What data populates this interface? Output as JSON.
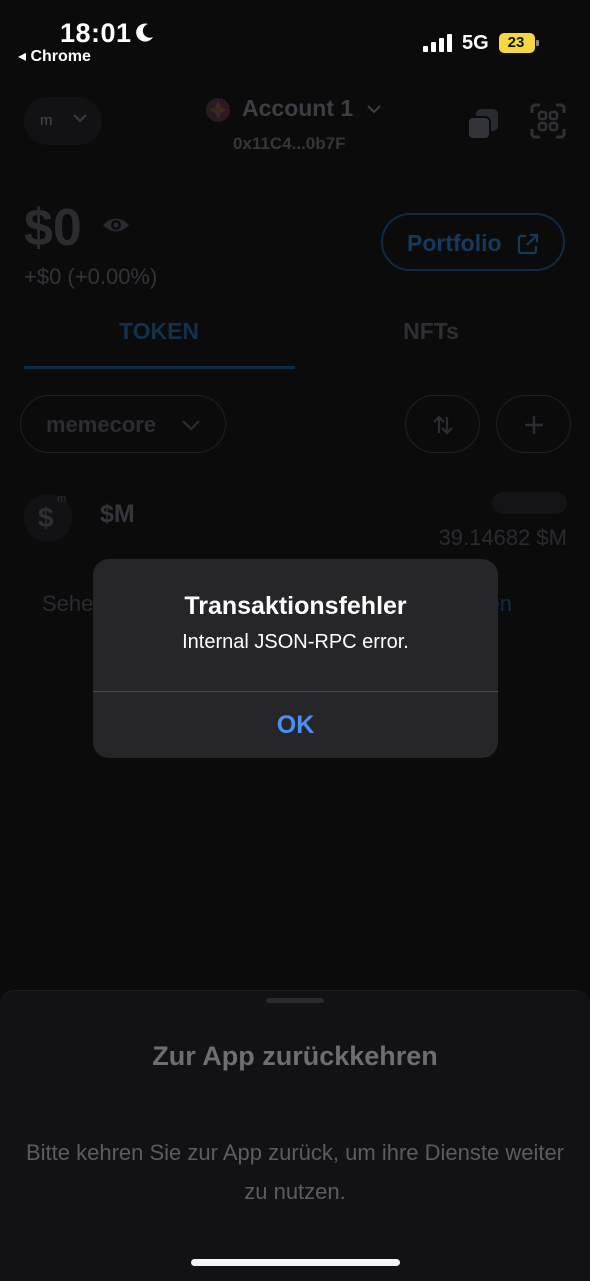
{
  "status_bar": {
    "time": "18:01",
    "back_app": "◂ Chrome",
    "network": "5G",
    "battery": "23"
  },
  "header": {
    "network_initial": "m",
    "account_name": "Account 1",
    "account_address": "0x11C4...0b7F"
  },
  "wallet": {
    "balance": "$0",
    "change": "+$0 (+0.00%)",
    "portfolio_label": "Portfolio"
  },
  "tabs": [
    {
      "label": "TOKEN",
      "active": true
    },
    {
      "label": "NFTs",
      "active": false
    }
  ],
  "filter": {
    "network_filter": "memecore"
  },
  "tokens": [
    {
      "symbol": "$M",
      "logo_glyph": "$",
      "badge": "m",
      "amount": "39.14682 $M"
    }
  ],
  "links": {
    "left_partial": "Sehe",
    "right_partial": "eren"
  },
  "alert": {
    "title": "Transaktionsfehler",
    "message": "Internal JSON-RPC error.",
    "ok_label": "OK"
  },
  "sheet": {
    "title": "Zur App zurückkehren",
    "body": "Bitte kehren Sie zur App zurück, um ihre Dienste weiter zu nutzen."
  },
  "colors": {
    "background": "#0b0b0c",
    "alert_bg": "#262629",
    "ok_blue": "#4b8ff2"
  }
}
